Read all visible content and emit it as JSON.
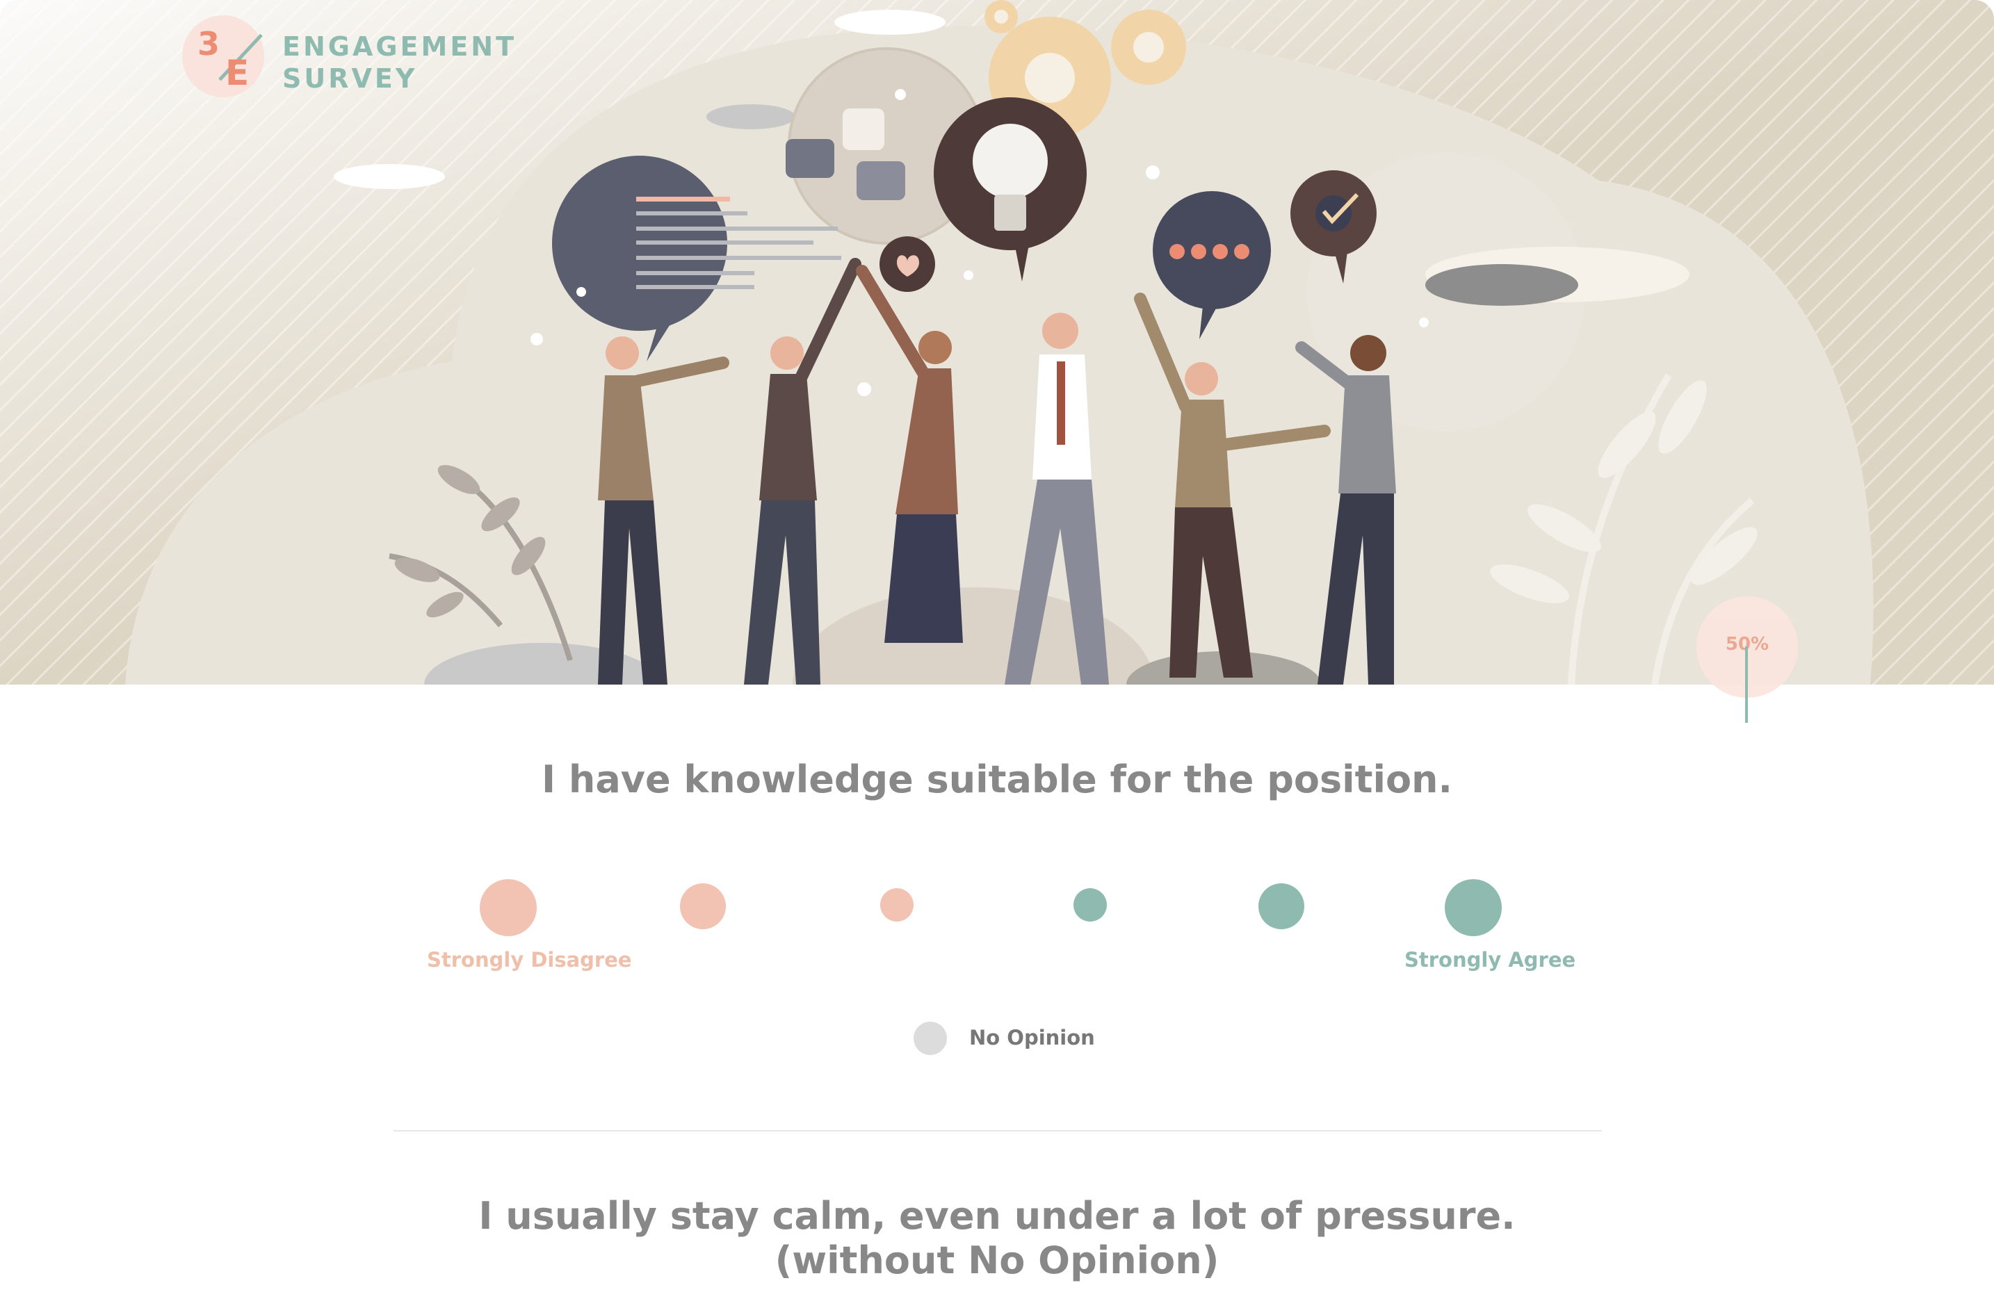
{
  "brand": {
    "logo_number": "3",
    "logo_letter": "E",
    "name_line1": "ENGAGEMENT",
    "name_line2": "SURVEY"
  },
  "progress": {
    "label": "50%",
    "value": 0.5
  },
  "colors": {
    "disagree": "#f2c3b2",
    "agree": "#8fbab0",
    "no_opinion": "#dcdcdc",
    "question_text": "#888888",
    "hero_bg": "#e8e4da"
  },
  "questions": [
    {
      "text": "I have knowledge suitable for the position.",
      "scale_left_label": "Strongly Disagree",
      "scale_right_label": "Strongly Agree",
      "options_count": 6,
      "no_opinion_label": "No Opinion"
    },
    {
      "text": "I usually stay calm, even under a lot of pressure. (without No Opinion)"
    }
  ]
}
